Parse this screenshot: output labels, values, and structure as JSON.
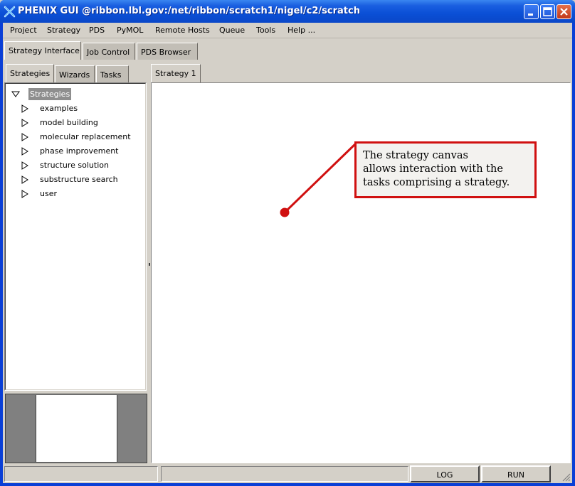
{
  "window": {
    "title": "PHENIX GUI @ribbon.lbl.gov:/net/ribbon/scratch1/nigel/c2/scratch"
  },
  "menu": [
    "Project",
    "Strategy",
    "PDS",
    "PyMOL",
    "Remote Hosts",
    "Queue",
    "Tools",
    "Help ..."
  ],
  "main_tabs": [
    "Strategy Interface",
    "Job Control",
    "PDS Browser"
  ],
  "left_tabs": [
    "Strategies",
    "Wizards",
    "Tasks"
  ],
  "canvas_tabs": [
    "Strategy 1"
  ],
  "tree": {
    "root": "Strategies",
    "items": [
      "examples",
      "model building",
      "molecular replacement",
      "phase improvement",
      "structure solution",
      "substructure search",
      "user"
    ]
  },
  "callout": {
    "text": "The strategy canvas\nallows interaction with the\ntasks comprising a strategy."
  },
  "buttons": {
    "log": "LOG",
    "run": "RUN"
  },
  "colors": {
    "titlebar": "#0a4fd6",
    "callout_border": "#d01010",
    "selection": "#8e8e8e"
  }
}
